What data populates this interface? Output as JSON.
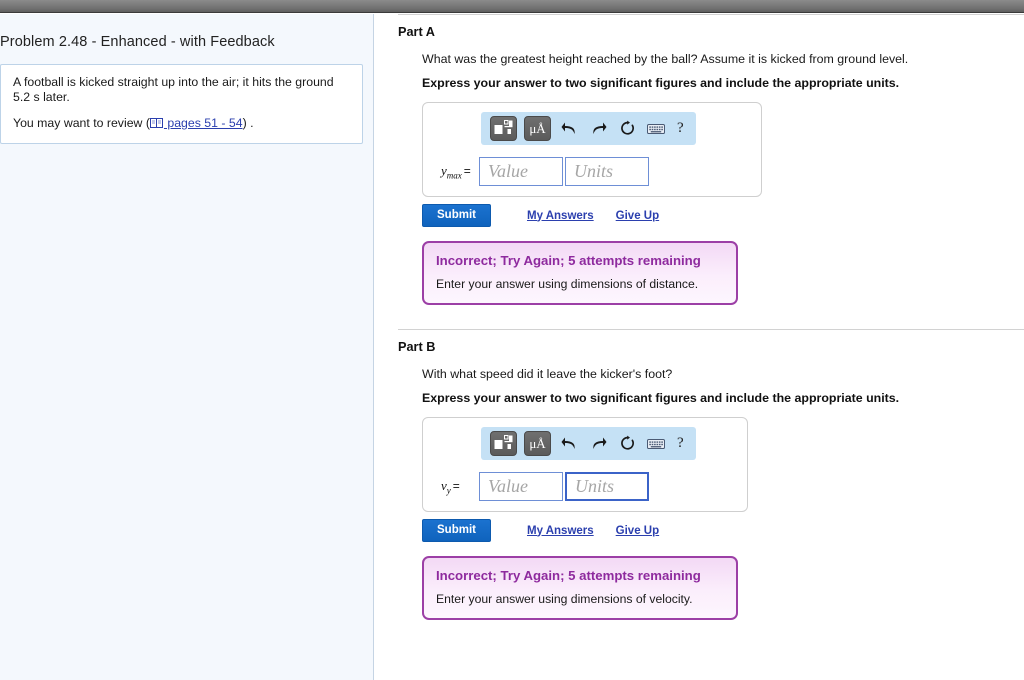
{
  "window": {
    "chrome_bar": "browser-chrome-bar"
  },
  "left_panel": {
    "title": "Problem 2.48 - Enhanced - with Feedback",
    "description": {
      "paragraph_1": "A football is kicked straight up into the air; it hits the ground 5.2  s later.",
      "review_prefix": "You may want to review (",
      "review_link": " pages 51 - 54",
      "review_suffix": ") ."
    }
  },
  "toolbar": {
    "template_icon": "formula-template-icon",
    "units_label": "μÅ",
    "undo_icon": "undo-arrow-icon",
    "redo_icon": "redo-arrow-icon",
    "reset_icon": "reset-circular-arrow-icon",
    "keyboard_icon": "keyboard-icon",
    "help_label": "?"
  },
  "actions": {
    "submit_label": "Submit",
    "my_answers_label": "My Answers",
    "give_up_label": "Give Up"
  },
  "fields": {
    "value_placeholder": "Value",
    "units_placeholder": "Units",
    "value_current": "",
    "units_current": ""
  },
  "parts": [
    {
      "heading": "Part A",
      "question": "What was the greatest height reached by the ball? Assume it is kicked from ground level.",
      "instruction": "Express your answer to two significant figures and include the appropriate units.",
      "variable_base": "y",
      "variable_sub": "max",
      "equals": "=",
      "feedback": {
        "title": "Incorrect; Try Again; 5 attempts remaining",
        "text": "Enter your answer using dimensions of distance."
      }
    },
    {
      "heading": "Part B",
      "question": "With what speed did it leave the kicker's foot?",
      "instruction": "Express your answer to two significant figures and include the appropriate units.",
      "variable_base": "v",
      "variable_sub": "y",
      "equals": "=",
      "feedback": {
        "title": "Incorrect; Try Again; 5 attempts remaining",
        "text": "Enter your answer using dimensions of velocity."
      }
    }
  ],
  "colors": {
    "accent_blue": "#1b72cf",
    "link_blue": "#2b3fae",
    "feedback_border": "#9c3fa6",
    "feedback_title": "#8e2a9e",
    "toolbar_bg": "#c5e1f5",
    "left_panel_bg": "#f4f8fd"
  }
}
